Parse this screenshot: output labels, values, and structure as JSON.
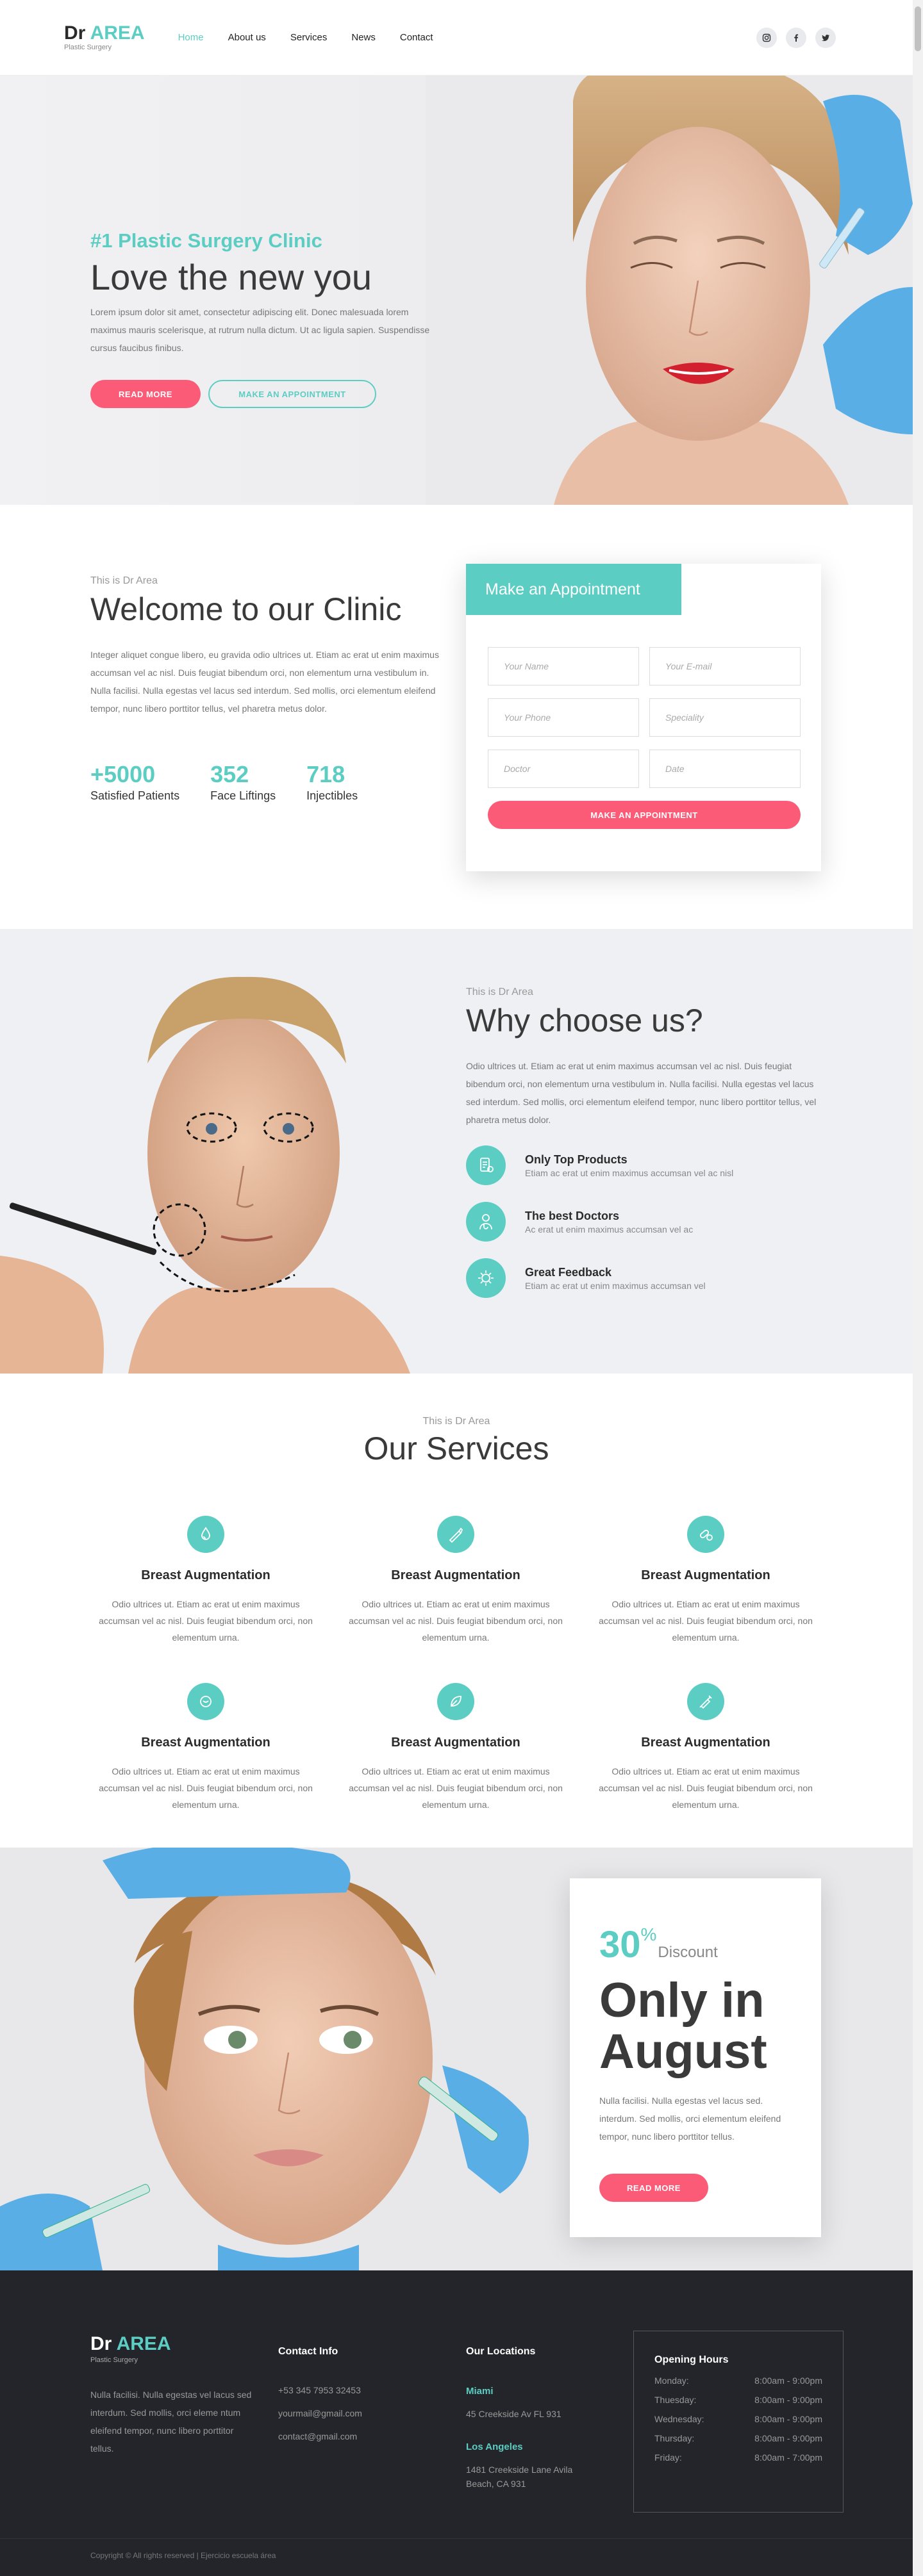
{
  "header": {
    "logo_main": "Dr ",
    "logo_accent": "AREA",
    "logo_sub": "Plastic Surgery",
    "nav": [
      {
        "label": "Home"
      },
      {
        "label": "About us"
      },
      {
        "label": "Services"
      },
      {
        "label": "News"
      },
      {
        "label": "Contact"
      }
    ],
    "social": {
      "instagram": "◎",
      "facebook": "f",
      "twitter": "t"
    }
  },
  "hero": {
    "kicker": "#1 Plastic Surgery Clinic",
    "title": "Love the new you",
    "body": "Lorem ipsum dolor sit amet, consectetur adipiscing elit. Donec malesuada lorem maximus mauris scelerisque, at rutrum nulla dictum. Ut ac ligula sapien. Suspendisse cursus faucibus finibus.",
    "btn_primary": "READ MORE",
    "btn_secondary": "MAKE AN APPOINTMENT"
  },
  "welcome": {
    "label": "This is Dr Area",
    "title": "Welcome to our Clinic",
    "body": "Integer aliquet congue libero, eu gravida odio ultrices ut. Etiam ac erat ut enim maximus accumsan vel ac nisl. Duis feugiat bibendum orci, non elementum urna vestibulum in. Nulla facilisi. Nulla egestas vel lacus sed interdum. Sed mollis, orci elementum eleifend tempor, nunc libero porttitor tellus, vel pharetra metus dolor.",
    "stats": [
      {
        "num": "+5000",
        "label": "Satisfied Patients"
      },
      {
        "num": "352",
        "label": "Face Liftings"
      },
      {
        "num": "718",
        "label": "Injectibles"
      }
    ]
  },
  "appointment": {
    "title": "Make an Appointment",
    "fields": {
      "name": "Your Name",
      "email": "Your E-mail",
      "phone": "Your Phone",
      "speciality": "Speciality",
      "doctor": "Doctor",
      "date": "Date"
    },
    "submit": "MAKE AN APPOINTMENT"
  },
  "why": {
    "label": "This is Dr Area",
    "title": "Why choose us?",
    "body": "Odio ultrices ut. Etiam ac erat ut enim maximus accumsan vel ac nisl. Duis feugiat bibendum orci, non elementum urna vestibulum in. Nulla facilisi. Nulla egestas vel lacus sed interdum. Sed mollis, orci elementum eleifend tempor, nunc libero porttitor tellus, vel pharetra metus dolor.",
    "features": [
      {
        "title": "Only Top Products",
        "desc": "Etiam ac erat ut enim maximus accumsan vel ac nisl",
        "icon": "products-icon"
      },
      {
        "title": "The best Doctors",
        "desc": "Ac erat ut enim maximus accumsan vel ac",
        "icon": "doctor-icon"
      },
      {
        "title": "Great Feedback",
        "desc": "Etiam ac erat ut enim maximus accumsan vel",
        "icon": "feedback-icon"
      }
    ]
  },
  "services": {
    "label": "This is Dr Area",
    "title": "Our Services",
    "items": [
      {
        "title": "Breast Augmentation",
        "desc": "Odio ultrices ut. Etiam ac erat ut enim maximus accumsan vel ac nisl. Duis feugiat bibendum orci, non elementum urna."
      },
      {
        "title": "Breast Augmentation",
        "desc": "Odio ultrices ut. Etiam ac erat ut enim maximus accumsan vel ac nisl. Duis feugiat bibendum orci, non elementum urna."
      },
      {
        "title": "Breast Augmentation",
        "desc": "Odio ultrices ut. Etiam ac erat ut enim maximus accumsan vel ac nisl. Duis feugiat bibendum orci, non elementum urna."
      },
      {
        "title": "Breast Augmentation",
        "desc": "Odio ultrices ut. Etiam ac erat ut enim maximus accumsan vel ac nisl. Duis feugiat bibendum orci, non elementum urna."
      },
      {
        "title": "Breast Augmentation",
        "desc": "Odio ultrices ut. Etiam ac erat ut enim maximus accumsan vel ac nisl. Duis feugiat bibendum orci, non elementum urna."
      },
      {
        "title": "Breast Augmentation",
        "desc": "Odio ultrices ut. Etiam ac erat ut enim maximus accumsan vel ac nisl. Duis feugiat bibendum orci, non elementum urna."
      }
    ]
  },
  "promo": {
    "percent": "30",
    "percent_symbol": "%",
    "discount_label": "Discount",
    "title": "Only in August",
    "body": "Nulla facilisi. Nulla egestas vel lacus sed. interdum. Sed mollis, orci elementum eleifend tempor, nunc libero porttitor tellus.",
    "button": "READ MORE"
  },
  "footer": {
    "logo_main": "Dr ",
    "logo_accent": "AREA",
    "logo_sub": "Plastic Surgery",
    "about": "Nulla facilisi. Nulla egestas vel lacus sed interdum. Sed mollis, orci eleme ntum eleifend tempor, nunc libero porttitor tellus.",
    "contact_title": "Contact Info",
    "contact": [
      "+53 345 7953 32453",
      "yourmail@gmail.com",
      "contact@gmail.com"
    ],
    "locations_title": "Our Locations",
    "loc1_city": "Miami",
    "loc1_addr": "45 Creekside Av FL 931",
    "loc2_city": "Los Angeles",
    "loc2_addr": "1481 Creekside Lane Avila Beach, CA 931",
    "hours_title": "Opening Hours",
    "hours": [
      {
        "day": "Monday:",
        "time": "8:00am - 9:00pm"
      },
      {
        "day": "Thuesday:",
        "time": "8:00am - 9:00pm"
      },
      {
        "day": "Wednesday:",
        "time": "8:00am - 9:00pm"
      },
      {
        "day": "Thursday:",
        "time": "8:00am - 9:00pm"
      },
      {
        "day": "Friday:",
        "time": "8:00am - 7:00pm"
      }
    ],
    "copyright": "Copyright © All rights reserved | Ejercicio escuela área"
  }
}
